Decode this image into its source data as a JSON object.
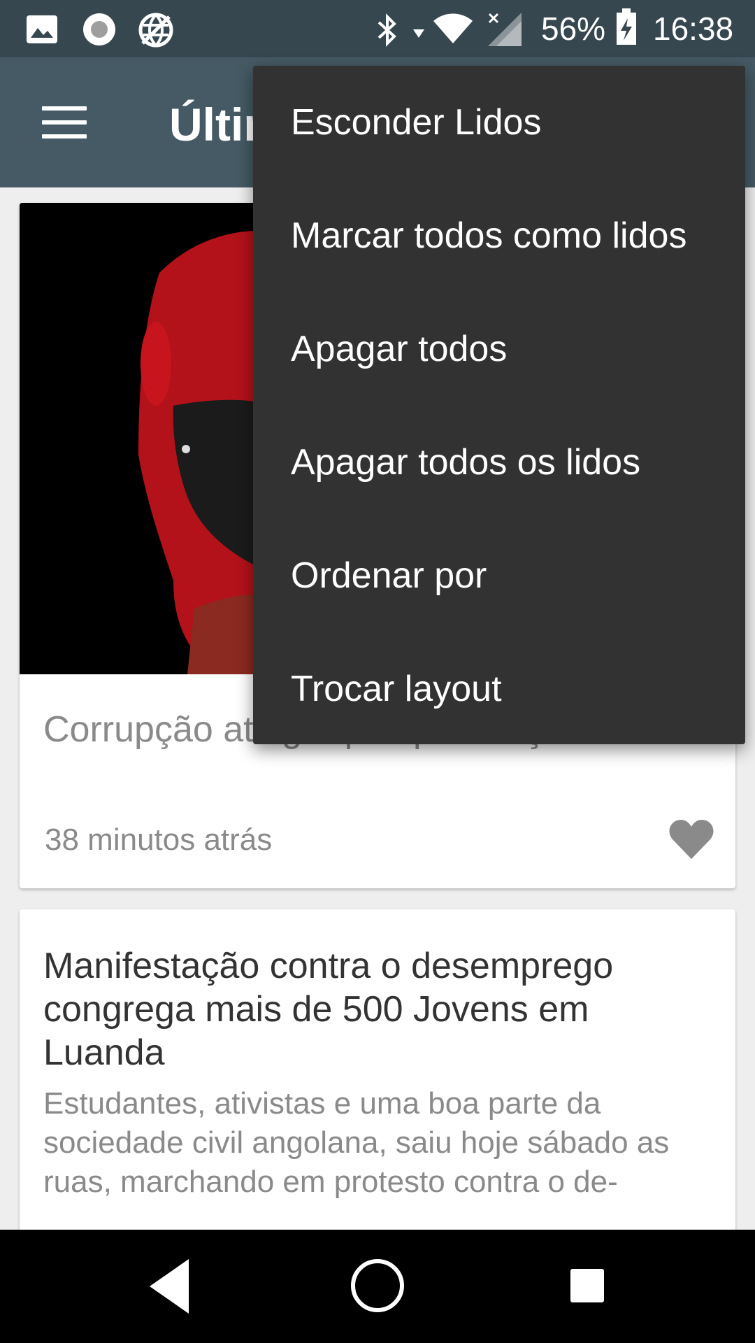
{
  "status_bar": {
    "battery": "56%",
    "time": "16:38",
    "left_icons": [
      "image-icon",
      "record-icon",
      "vpn-globe-icon"
    ],
    "right_icons": [
      "bluetooth-icon",
      "wifi-icon",
      "signal-icon",
      "battery-icon"
    ]
  },
  "app_bar": {
    "title": "Últimas"
  },
  "overflow_menu": {
    "items": [
      "Esconder Lidos",
      "Marcar todos como lidos",
      "Apagar todos",
      "Apagar todos os lidos",
      "Ordenar por",
      "Trocar layout"
    ]
  },
  "articles": [
    {
      "title": "Corrupção atinge qualquer nação - PGR",
      "time": "38 minutos atrás"
    },
    {
      "title": "Manifestação contra o desemprego congrega mais de 500 Jovens em Luanda",
      "summary": "Estudantes, ativistas e uma boa parte da sociedade civil angolana, saiu hoje sábado as ruas, marchando em protesto contra o de-"
    }
  ],
  "colors": {
    "status_bar": "#37474f",
    "app_bar": "#455a64",
    "menu_bg": "#323232",
    "background": "#eeeeee"
  }
}
